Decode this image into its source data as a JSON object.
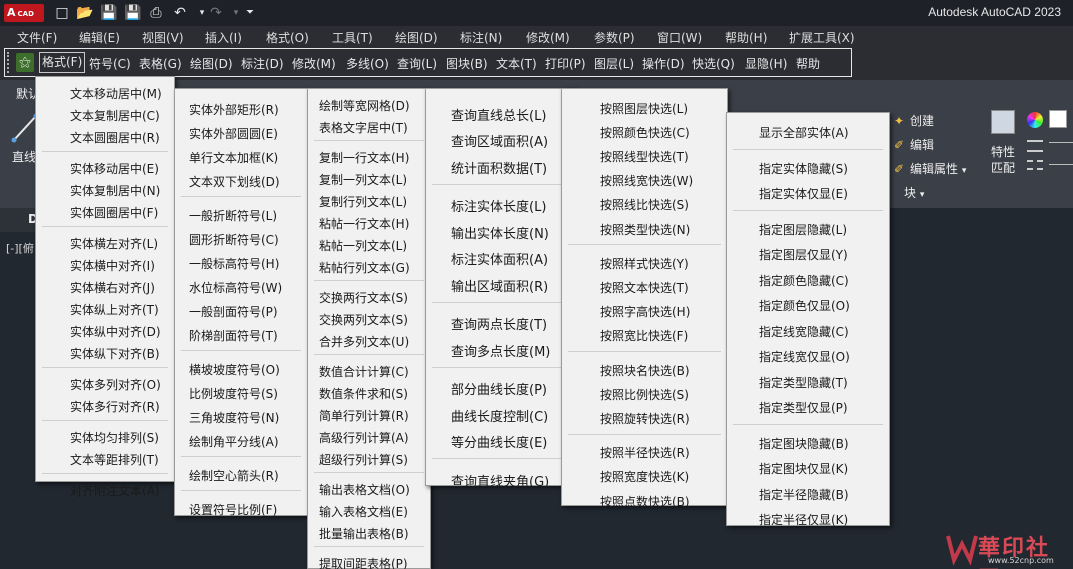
{
  "app": {
    "title": "Autodesk AutoCAD 2023",
    "logo_letter": "A",
    "logo_sub": "CAD"
  },
  "quick_access": [
    "new-icon",
    "open-icon",
    "save-icon",
    "save-as-icon",
    "publish-icon",
    "print-icon",
    "undo-icon",
    "redo-icon",
    "customize-icon"
  ],
  "menubar": [
    "文件(F)",
    "编辑(E)",
    "视图(V)",
    "插入(I)",
    "格式(O)",
    "工具(T)",
    "绘图(D)",
    "标注(N)",
    "修改(M)",
    "参数(P)",
    "窗口(W)",
    "帮助(H)",
    "扩展工具(X)"
  ],
  "custom_toolbar": [
    "格式(F)",
    "符号(C)",
    "表格(G)",
    "绘图(D)",
    "标注(D)",
    "修改(M)",
    "多线(O)",
    "查询(L)",
    "图块(B)",
    "文本(T)",
    "打印(P)",
    "图层(L)",
    "操作(D)",
    "快选(Q)",
    "显隐(H)",
    "帮助"
  ],
  "ribbon": {
    "tab_default": "默认",
    "line_label": "直线",
    "block_panel": {
      "create": "创建",
      "edit": "编辑",
      "edit_attr": "编辑属性",
      "title": "块"
    },
    "prop_panel": {
      "match": "特性\n匹配"
    }
  },
  "canvas": {
    "doc_tab": "D",
    "viewport_label": "[-][俯"
  },
  "menus": {
    "m1": [
      "文本移动居中(M)",
      "文本复制居中(C)",
      "文本圆圈居中(R)",
      "|",
      "实体移动居中(E)",
      "实体复制居中(N)",
      "实体圆圈居中(F)",
      "|",
      "实体横左对齐(L)",
      "实体横中对齐(I)",
      "实体横右对齐(J)",
      "实体纵上对齐(T)",
      "实体纵中对齐(D)",
      "实体纵下对齐(B)",
      "|",
      "实体多列对齐(O)",
      "实体多行对齐(R)",
      "|",
      "实体均匀排列(S)",
      "文本等距排列(T)",
      "|",
      "对齐附注文本(A)"
    ],
    "m2": [
      "实体外部矩形(R)",
      "实体外部圆圆(E)",
      "单行文本加框(K)",
      "文本双下划线(D)",
      "|",
      "一般折断符号(L)",
      "圆形折断符号(C)",
      "一般标高符号(H)",
      "水位标高符号(W)",
      "一般剖面符号(P)",
      "阶梯剖面符号(T)",
      "|",
      "横坡坡度符号(O)",
      "比例坡度符号(S)",
      "三角坡度符号(N)",
      "绘制角平分线(A)",
      "|",
      "绘制空心箭头(R)",
      "|",
      "设置符号比例(F)"
    ],
    "m3": [
      "绘制等宽网格(D)",
      "表格文字居中(T)",
      "|",
      "复制一行文本(H)",
      "复制一列文本(L)",
      "复制行列文本(L)",
      "粘帖一行文本(H)",
      "粘帖一列文本(L)",
      "粘帖行列文本(G)",
      "|",
      "交换两行文本(S)",
      "交换两列文本(S)",
      "合并多列文本(U)",
      "|",
      "数值合计计算(C)",
      "数值条件求和(S)",
      "简单行列计算(R)",
      "高级行列计算(A)",
      "超级行列计算(S)",
      "|",
      "输出表格文档(O)",
      "输入表格文档(E)",
      "批量输出表格(B)",
      "|",
      "提取间距表格(P)"
    ],
    "m4": [
      "查询直线总长(L)",
      "查询区域面积(A)",
      "统计面积数据(T)",
      "|",
      "标注实体长度(L)",
      "输出实体长度(N)",
      "标注实体面积(A)",
      "输出区域面积(R)",
      "|",
      "查询两点长度(T)",
      "查询多点长度(M)",
      "|",
      "部分曲线长度(P)",
      "曲线长度控制(C)",
      "等分曲线长度(E)",
      "|",
      "查询直线夹角(G)"
    ],
    "m5": [
      "按照图层快选(L)",
      "按照颜色快选(C)",
      "按照线型快选(T)",
      "按照线宽快选(W)",
      "按照线比快选(S)",
      "按照类型快选(N)",
      "|",
      "按照样式快选(Y)",
      "按照文本快选(T)",
      "按照字高快选(H)",
      "按照宽比快选(F)",
      "|",
      "按照块名快选(B)",
      "按照比例快选(S)",
      "按照旋转快选(R)",
      "|",
      "按照半径快选(R)",
      "按照宽度快选(K)",
      "按照点数快选(B)"
    ],
    "m6": [
      "显示全部实体(A)",
      "|",
      "指定实体隐藏(S)",
      "指定实体仅显(E)",
      "|",
      "指定图层隐藏(L)",
      "指定图层仅显(Y)",
      "指定颜色隐藏(C)",
      "指定颜色仅显(O)",
      "指定线宽隐藏(C)",
      "指定线宽仅显(O)",
      "指定类型隐藏(T)",
      "指定类型仅显(P)",
      "|",
      "指定图块隐藏(B)",
      "指定图块仅显(K)",
      "指定半径隐藏(B)",
      "指定半径仅显(K)"
    ]
  },
  "watermark": {
    "text": "華印社區",
    "url": "www.52cnp.com"
  }
}
